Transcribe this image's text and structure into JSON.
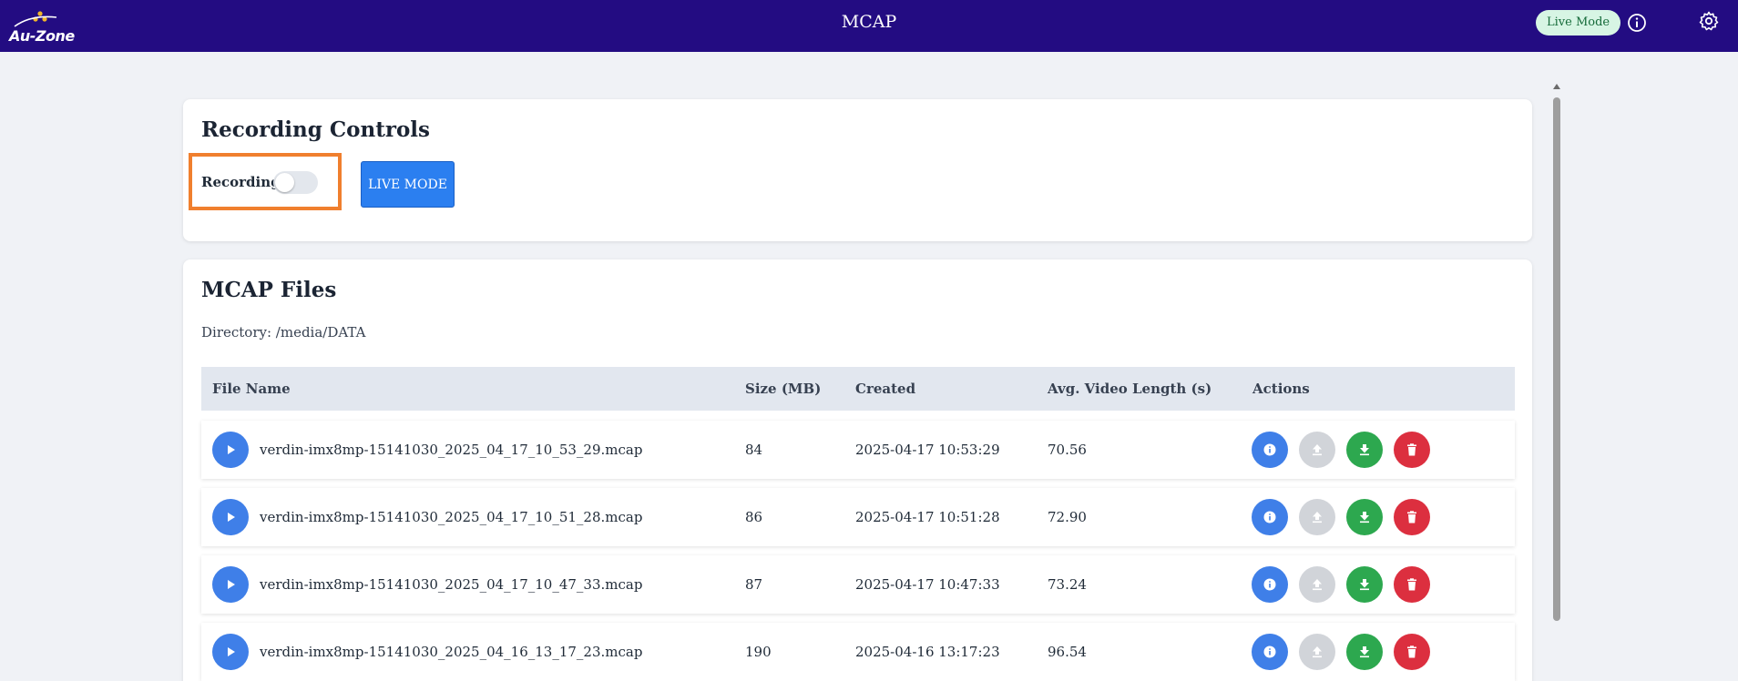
{
  "header": {
    "logo_text": "Au-Zone",
    "title": "MCAP",
    "live_badge": "Live Mode"
  },
  "recording": {
    "title": "Recording Controls",
    "toggle_label": "Recording",
    "toggle_on": false,
    "live_button": "LIVE MODE"
  },
  "files": {
    "title": "MCAP Files",
    "directory": "Directory: /media/DATA",
    "columns": {
      "name": "File Name",
      "size": "Size (MB)",
      "created": "Created",
      "avg": "Avg. Video Length (s)",
      "actions": "Actions"
    },
    "rows": [
      {
        "name": "verdin-imx8mp-15141030_2025_04_17_10_53_29.mcap",
        "size": "84",
        "created": "2025-04-17 10:53:29",
        "avg": "70.56"
      },
      {
        "name": "verdin-imx8mp-15141030_2025_04_17_10_51_28.mcap",
        "size": "86",
        "created": "2025-04-17 10:51:28",
        "avg": "72.90"
      },
      {
        "name": "verdin-imx8mp-15141030_2025_04_17_10_47_33.mcap",
        "size": "87",
        "created": "2025-04-17 10:47:33",
        "avg": "73.24"
      },
      {
        "name": "verdin-imx8mp-15141030_2025_04_16_13_17_23.mcap",
        "size": "190",
        "created": "2025-04-16 13:17:23",
        "avg": "96.54"
      }
    ]
  },
  "icons": {
    "play": "play-icon",
    "info": "info-icon",
    "upload": "upload-icon",
    "download": "download-icon",
    "delete": "trash-icon",
    "settings": "gear-icon"
  },
  "colors": {
    "topbar": "#230c82",
    "accent_blue": "#3f7fe8",
    "download_green": "#2da84f",
    "delete_red": "#dc2f3f",
    "highlight": "#f07f2e"
  }
}
